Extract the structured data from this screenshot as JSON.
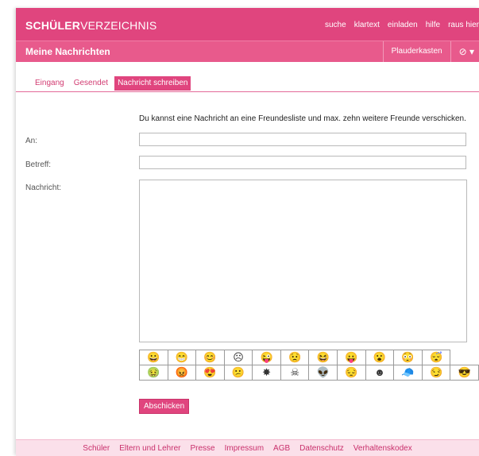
{
  "header": {
    "logo_bold": "SCHÜLER",
    "logo_light": "VERZEICHNIS",
    "nav": [
      "suche",
      "klartext",
      "einladen",
      "hilfe",
      "raus hier"
    ]
  },
  "subheader": {
    "title": "Meine Nachrichten",
    "plauderkasten": "Plauderkasten",
    "status_icon": "check-circle-icon"
  },
  "tabs": [
    {
      "label": "Eingang",
      "active": false
    },
    {
      "label": "Gesendet",
      "active": false
    },
    {
      "label": "Nachricht schreiben",
      "active": true
    }
  ],
  "form": {
    "intro": "Du kannst eine Nachricht an eine Freundesliste und max. zehn weitere Freunde verschicken.",
    "to_label": "An:",
    "to_value": "",
    "subject_label": "Betreff:",
    "subject_value": "",
    "message_label": "Nachricht:",
    "message_value": "",
    "submit_label": "Abschicken"
  },
  "smileys": [
    [
      "smile-icon",
      "grin-icon",
      "happy-icon",
      "frown-icon",
      "wink-tongue-icon",
      "worried-icon",
      "laugh-icon",
      "tongue-icon",
      "surprised-icon",
      "blush-icon",
      "sleepy-icon"
    ],
    [
      "green-sick-icon",
      "angry-icon",
      "pink-love-icon",
      "confused-icon",
      "explode-icon",
      "skull-icon",
      "alien-icon",
      "sad-icon",
      "black-hair-icon",
      "ghost-icon",
      "cap-icon",
      "smirk-icon",
      "cool-icon"
    ]
  ],
  "footer": {
    "links": [
      "Schüler",
      "Eltern und Lehrer",
      "Presse",
      "Impressum",
      "AGB",
      "Datenschutz",
      "Verhaltenskodex"
    ]
  },
  "colors": {
    "brand": "#e0457e",
    "subbar": "#e85a8c",
    "footer_bg": "#fbe0ea"
  }
}
